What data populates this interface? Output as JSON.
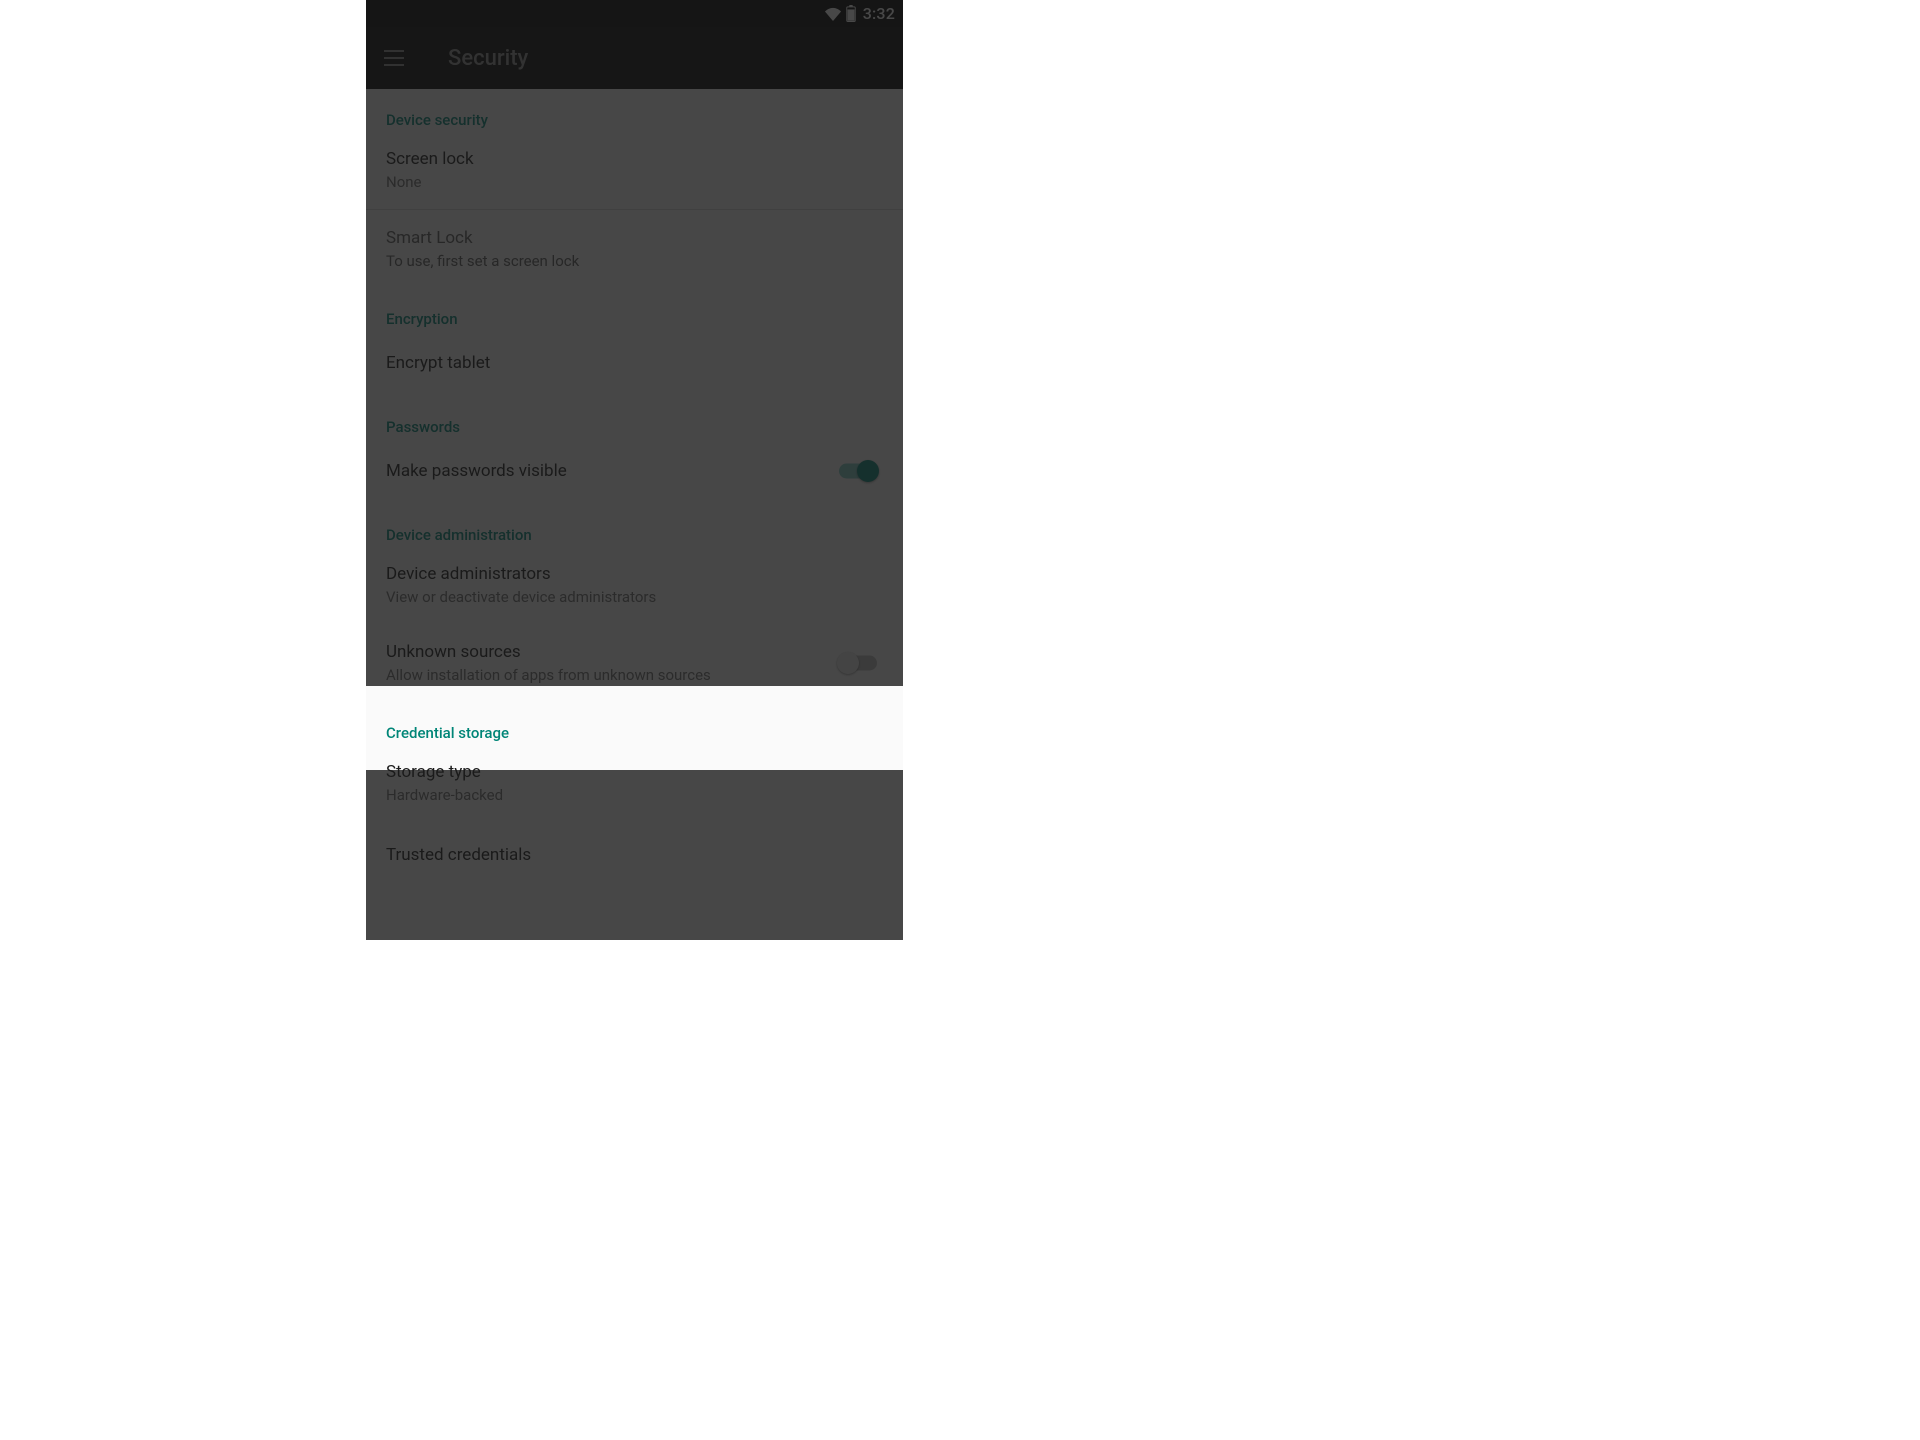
{
  "status": {
    "time": "3:32"
  },
  "appbar": {
    "title": "Security"
  },
  "accent": "#008577",
  "sections": {
    "device_security": {
      "header": "Device security",
      "screen_lock": {
        "title": "Screen lock",
        "subtitle": "None"
      },
      "smart_lock": {
        "title": "Smart Lock",
        "subtitle": "To use, first set a screen lock"
      }
    },
    "encryption": {
      "header": "Encryption",
      "encrypt_tablet": {
        "title": "Encrypt tablet"
      }
    },
    "passwords": {
      "header": "Passwords",
      "visible": {
        "title": "Make passwords visible",
        "on": true
      }
    },
    "device_admin": {
      "header": "Device administration",
      "admins": {
        "title": "Device administrators",
        "subtitle": "View or deactivate device administrators"
      },
      "unknown_sources": {
        "title": "Unknown sources",
        "subtitle": "Allow installation of apps from unknown sources",
        "on": false
      }
    },
    "credential_storage": {
      "header": "Credential storage",
      "storage_type": {
        "title": "Storage type",
        "subtitle": "Hardware-backed"
      },
      "trusted": {
        "title": "Trusted credentials"
      }
    }
  }
}
